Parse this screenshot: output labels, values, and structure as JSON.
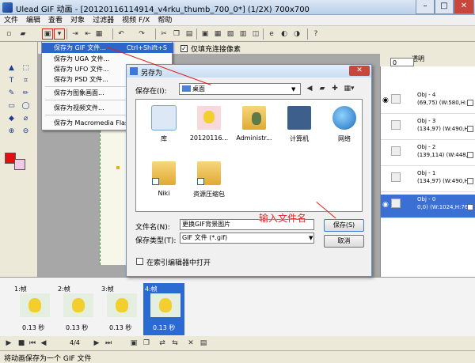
{
  "window": {
    "title": "Ulead GIF 动画 - [20120116114914_v4rku_thumb_700_0*] (1/2X)  700x700",
    "btn_min": "–",
    "btn_max": "□",
    "btn_close": "✕"
  },
  "menu": [
    "文件",
    "编辑",
    "查看",
    "对象",
    "过滤器",
    "视频 F/X",
    "帮助"
  ],
  "props": {
    "label": "相似",
    "value": "32",
    "checkbox": "仅填充连接像素"
  },
  "context_menu": {
    "items": [
      {
        "label": "保存为 GIF 文件...",
        "shortcut": "Ctrl+Shift+S"
      },
      {
        "label": "保存为 UGA 文件..."
      },
      {
        "label": "保存为 UFO 文件..."
      },
      {
        "label": "保存为 PSD 文件..."
      },
      {
        "label": "保存为图象画面..."
      },
      {
        "label": "保存为视频文件..."
      },
      {
        "label": "保存为 Macromedia Flas"
      }
    ]
  },
  "dialog": {
    "title": "另存为",
    "save_in_label": "保存在(I):",
    "save_in_value": "桌面",
    "files": [
      {
        "name": "库",
        "icon": "library-folder"
      },
      {
        "name": "20120116...",
        "icon": "pikachu-image"
      },
      {
        "name": "Administr...",
        "icon": "user-folder"
      },
      {
        "name": "计算机",
        "icon": "computer"
      },
      {
        "name": "网络",
        "icon": "network-globe"
      },
      {
        "name": "Niki",
        "icon": "shortcut-folder"
      },
      {
        "name": "资源压缩包",
        "icon": "shortcut-folder"
      }
    ],
    "filename_label": "文件名(N):",
    "filename_value": "更换GIF背景图片",
    "annotation": "输入文件名",
    "filetype_label": "保存类型(T):",
    "filetype_value": "GIF 文件 (*.gif)",
    "save_button": "保存(S)",
    "cancel_button": "取消",
    "open_in_editor": "在索引编辑器中打开"
  },
  "object_panel": {
    "transparent_label": "透明",
    "transparent_value": "0",
    "objects": [
      {
        "name": "Obj - 4",
        "info": "(69,75) (W:580,H:6"
      },
      {
        "name": "Obj - 3",
        "info": "(134,97) (W:490,H:"
      },
      {
        "name": "Obj - 2",
        "info": "(139,114) (W:448,H"
      },
      {
        "name": "Obj - 1",
        "info": "(134,97) (W:490,H:"
      },
      {
        "name": "Obj - 0",
        "info": "0,0) (W:1024,H:76"
      }
    ]
  },
  "frames": [
    {
      "label": "1:帧",
      "duration": "0.13 秒"
    },
    {
      "label": "2:帧",
      "duration": "0.13 秒"
    },
    {
      "label": "3:帧",
      "duration": "0.13 秒"
    },
    {
      "label": "4:帧",
      "duration": "0.13 秒"
    }
  ],
  "playbar": {
    "counter": "4/4"
  },
  "status": {
    "text": "将动画保存为一个 GIF 文件"
  },
  "colors": {
    "accent": "#2d65c8",
    "annotation_red": "#e02020",
    "folder": "#e8b84a"
  }
}
